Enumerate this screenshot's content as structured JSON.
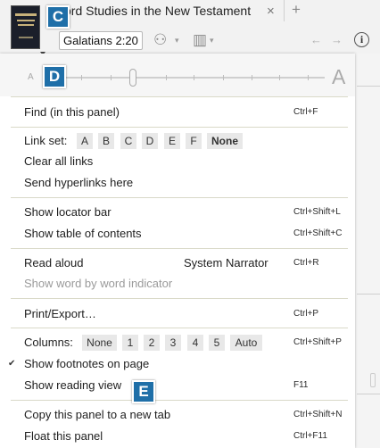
{
  "tab": {
    "title": "ord Studies in the New Testament",
    "close": "×",
    "add": "+"
  },
  "toolbar": {
    "reference_value": "Galatians 2:20",
    "help": "i"
  },
  "slider": {
    "small_label": "A",
    "large_label": "A",
    "level_fraction": 0.31
  },
  "callouts": {
    "c": "C",
    "d": "D",
    "e": "E"
  },
  "menu": {
    "find": {
      "label": "Find (in this panel)",
      "shortcut": "Ctrl+F"
    },
    "link_set": {
      "label": "Link set:",
      "options": [
        "A",
        "B",
        "C",
        "D",
        "E",
        "F",
        "None"
      ]
    },
    "clear_links": {
      "label": "Clear all links"
    },
    "send_hyperlinks": {
      "label": "Send hyperlinks here"
    },
    "locator_bar": {
      "label": "Show locator bar",
      "shortcut": "Ctrl+Shift+L"
    },
    "toc": {
      "label": "Show table of contents",
      "shortcut": "Ctrl+Shift+C"
    },
    "read_aloud": {
      "label": "Read aloud",
      "value": "System Narrator",
      "shortcut": "Ctrl+R"
    },
    "word_indicator": {
      "label": "Show word by word indicator",
      "disabled": true
    },
    "print_export": {
      "label": "Print/Export…",
      "shortcut": "Ctrl+P"
    },
    "columns": {
      "label": "Columns:",
      "options": [
        "None",
        "1",
        "2",
        "3",
        "4",
        "5",
        "Auto"
      ],
      "shortcut": "Ctrl+Shift+P"
    },
    "footnotes": {
      "label": "Show footnotes on page",
      "checked": true,
      "check_glyph": "✔"
    },
    "reading_view": {
      "label": "Show reading view",
      "shortcut": "F11"
    },
    "copy_panel": {
      "label": "Copy this panel to a new tab",
      "shortcut": "Ctrl+Shift+N"
    },
    "float_panel": {
      "label": "Float this panel",
      "shortcut": "Ctrl+F11"
    }
  },
  "icons": {
    "visual_filter": "⚇",
    "panel_layout": "▥",
    "back": "←",
    "forward": "→",
    "dropdown": "▾"
  }
}
